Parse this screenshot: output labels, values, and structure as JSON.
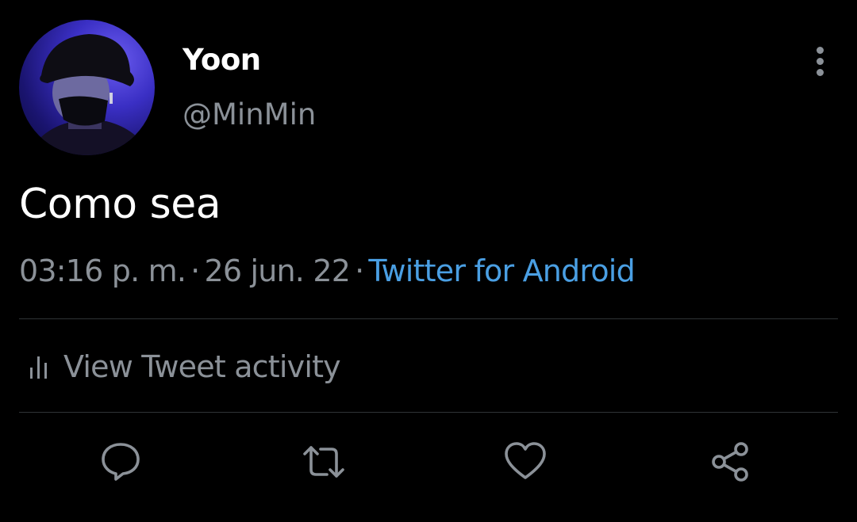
{
  "author": {
    "display_name": "Yoon",
    "handle": "@MinMin"
  },
  "tweet": {
    "text": "Como sea",
    "time": "03:16 p. m.",
    "separator": "·",
    "date": "26 jun. 22",
    "source": "Twitter for Android"
  },
  "activity": {
    "label": "View Tweet activity"
  },
  "actions": [
    "reply-icon",
    "retweet-icon",
    "like-icon",
    "share-icon"
  ],
  "colors": {
    "background": "#000000",
    "primary_text": "#ffffff",
    "secondary_text": "#8b9198",
    "link": "#4a9fe3",
    "divider": "#2f3336"
  }
}
